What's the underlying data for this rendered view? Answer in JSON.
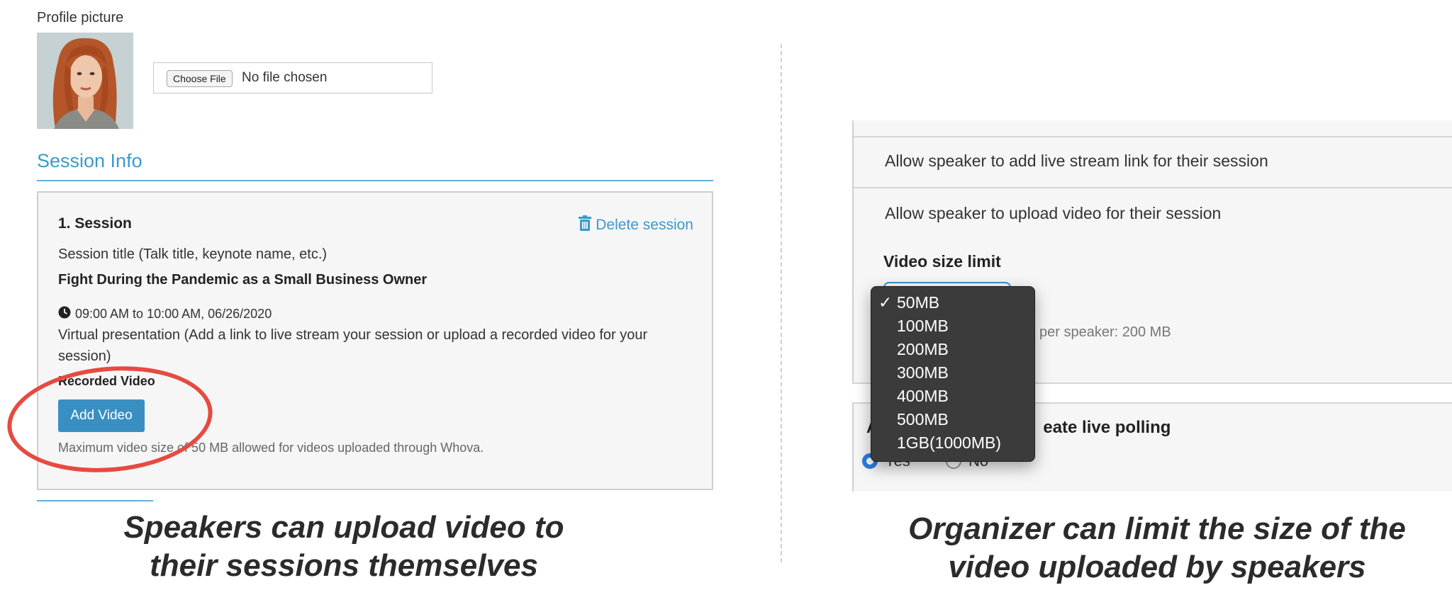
{
  "left": {
    "profile_label": "Profile picture",
    "file_input": {
      "button": "Choose File",
      "status": "No file chosen"
    },
    "session_info_heading": "Session Info",
    "session": {
      "number": "1. Session",
      "delete": "Delete session",
      "title_label": "Session title (Talk title, keynote name, etc.)",
      "title_value": "Fight During the Pandemic as a Small Business Owner",
      "time": "09:00 AM to 10:00 AM, 06/26/2020",
      "virtual_desc": "Virtual presentation (Add a link to live stream your session or upload a recorded video for your session)",
      "recorded_video_label": "Recorded Video",
      "add_video_button": "Add Video",
      "max_size_note": "Maximum video size of 50 MB allowed for videos uploaded through Whova."
    },
    "caption_line1": "Speakers can upload video to",
    "caption_line2": "their sessions themselves"
  },
  "right": {
    "row_live_stream": "Allow speaker to add live stream link for their session",
    "row_upload_video": "Allow speaker to upload video for their session",
    "video_size_limit_label": "Video size limit",
    "per_speaker_note": "per speaker: 200 MB",
    "polling_label_prefix": "A",
    "polling_label_suffix": "eate live polling",
    "radio_yes": "Yes",
    "radio_no": "No",
    "dropdown": {
      "selected": "50MB",
      "check_mark": "✓",
      "options": [
        "50MB",
        "100MB",
        "200MB",
        "300MB",
        "400MB",
        "500MB",
        "1GB(1000MB)"
      ]
    },
    "caption_line1": "Organizer can limit the size of the",
    "caption_line2": "video uploaded by speakers"
  },
  "colors": {
    "accent": "#3c9ac9",
    "button_blue": "#3a8fc2",
    "highlight_ellipse": "#e64a40",
    "dropdown_bg": "#3b3b3b"
  }
}
